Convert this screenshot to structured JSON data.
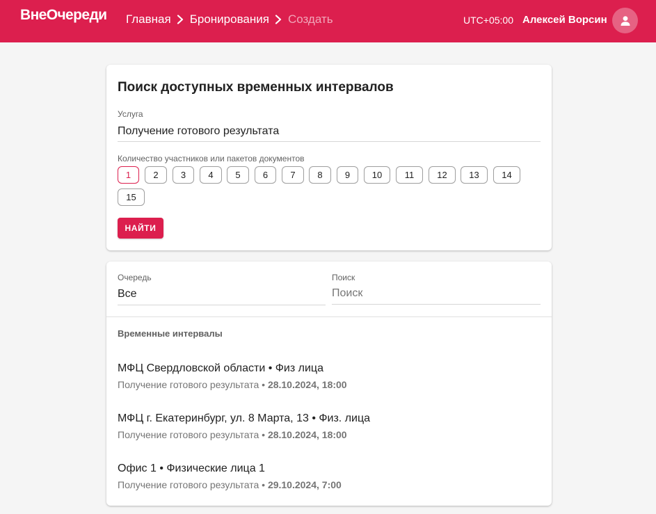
{
  "header": {
    "logo": "ВнеОчереди",
    "breadcrumbs": [
      "Главная",
      "Бронирования",
      "Создать"
    ],
    "timezone": "UTC+05:00",
    "user_name": "Алексей Ворсин",
    "colors": {
      "brand": "#dc1f4e"
    }
  },
  "search_form": {
    "title": "Поиск доступных временных интервалов",
    "service_label": "Услуга",
    "service_value": "Получение готового результата",
    "participants_label": "Количество участников или пакетов документов",
    "participants_options": [
      "1",
      "2",
      "3",
      "4",
      "5",
      "6",
      "7",
      "8",
      "9",
      "10",
      "11",
      "12",
      "13",
      "14",
      "15"
    ],
    "participants_selected": "1",
    "find_button": "НАЙТИ"
  },
  "results": {
    "queue_label": "Очередь",
    "queue_value": "Все",
    "search_label": "Поиск",
    "search_placeholder": "Поиск",
    "section_title": "Временные интервалы",
    "slots": [
      {
        "title": "МФЦ Свердловской области • Физ лица",
        "service": "Получение готового результата",
        "sep": " • ",
        "datetime": "28.10.2024, 18:00"
      },
      {
        "title": "МФЦ г. Екатеринбург, ул. 8 Марта, 13 • Физ. лица",
        "service": "Получение готового результата",
        "sep": " • ",
        "datetime": "28.10.2024, 18:00"
      },
      {
        "title": "Офис 1 • Физические лица 1",
        "service": "Получение готового результата",
        "sep": " • ",
        "datetime": "29.10.2024, 7:00"
      }
    ]
  }
}
